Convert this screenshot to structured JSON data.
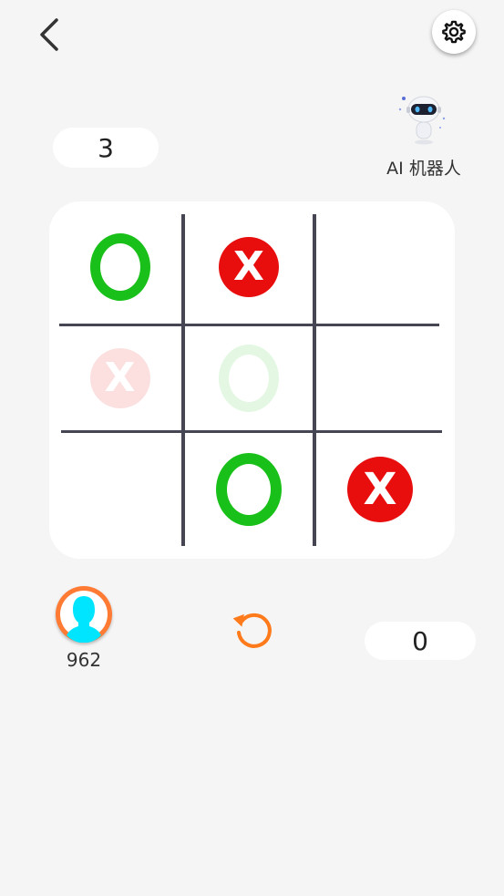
{
  "header": {
    "back_icon": "chevron-left-icon",
    "settings_icon": "gear-icon"
  },
  "ai": {
    "score": "3",
    "label": "AI 机器人",
    "avatar_icon": "robot-icon"
  },
  "player": {
    "score": "0",
    "name": "962",
    "avatar_icon": "user-silhouette-icon"
  },
  "controls": {
    "restart_icon": "restart-icon"
  },
  "board": {
    "cells": [
      [
        "O",
        "X",
        ""
      ],
      [
        "X",
        "O",
        ""
      ],
      [
        "",
        "O",
        "X"
      ]
    ],
    "faded_cells": [
      "row2-col1",
      "row2-col2"
    ]
  },
  "colors": {
    "background": "#f5f5f5",
    "x_piece": "#e80e0e",
    "o_piece": "#19c019",
    "grid": "#454553",
    "accent": "#ff7a33",
    "avatar_silhouette": "#00e5ff"
  }
}
